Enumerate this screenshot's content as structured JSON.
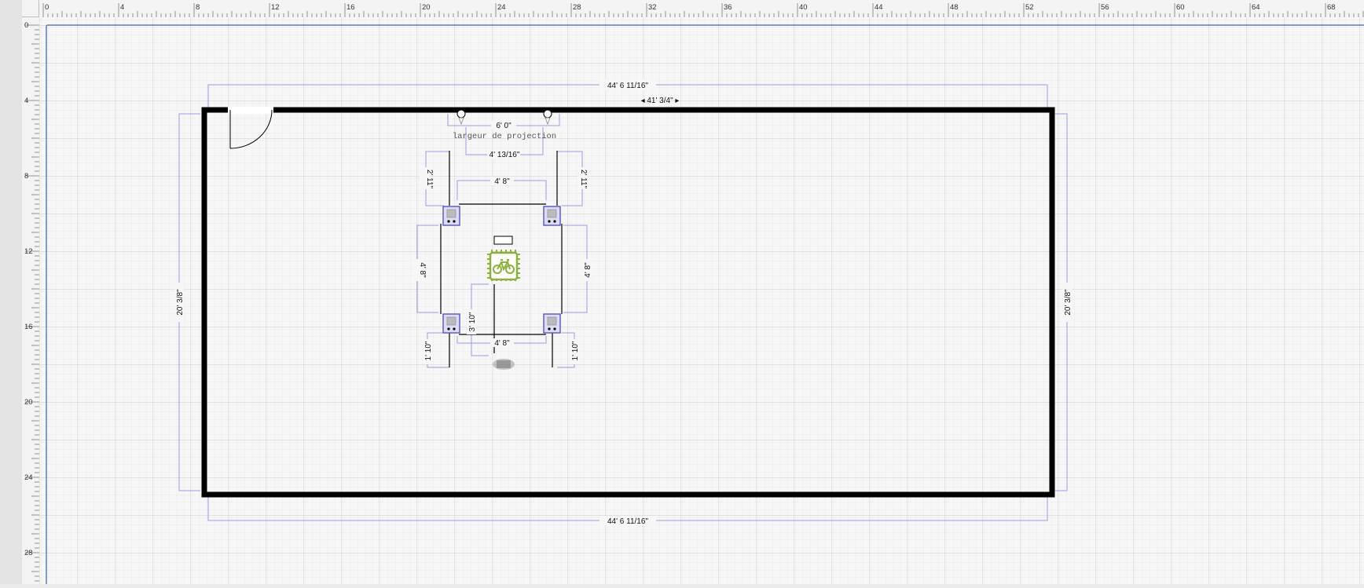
{
  "rulers": {
    "top_labels": [
      "0",
      "4",
      "8",
      "12",
      "16",
      "20",
      "24",
      "28",
      "32",
      "36",
      "40",
      "44",
      "48",
      "52",
      "56",
      "60",
      "64",
      "68"
    ],
    "left_labels": [
      "0",
      "4",
      "8",
      "12",
      "16",
      "20",
      "24",
      "28"
    ]
  },
  "room": {
    "top_outer_width": "44' 6 11/16\"",
    "bottom_outer_width": "44' 6 11/16\"",
    "inner_width_label": "◂ 41' 3/4\" ▸",
    "left_height": "20' 3/8\"",
    "right_height": "20' 3/8\""
  },
  "projection": {
    "width_label": "6' 0\"",
    "caption": "largeur de projection",
    "inner_span": "4' 13/16\""
  },
  "setup": {
    "left_top_offset": "2' 11\"",
    "right_top_offset": "2' 11\"",
    "top_span": "4' 8\"",
    "left_side": "4' 8\"",
    "right_side": "4' 8\"",
    "center_offset": "3' 10\"",
    "bottom_span": "4' 8\"",
    "left_bottom_offset": "1' 10\"",
    "right_bottom_offset": "1' 10\""
  },
  "colors": {
    "dimension": "#9a9ae8",
    "wall": "#000000",
    "bike": "#8ab339",
    "speaker": "#4a4ac8"
  },
  "icons": {
    "bike": "bicycle-chip-icon",
    "speaker": "speaker-icon",
    "projector": "projector-icon"
  }
}
